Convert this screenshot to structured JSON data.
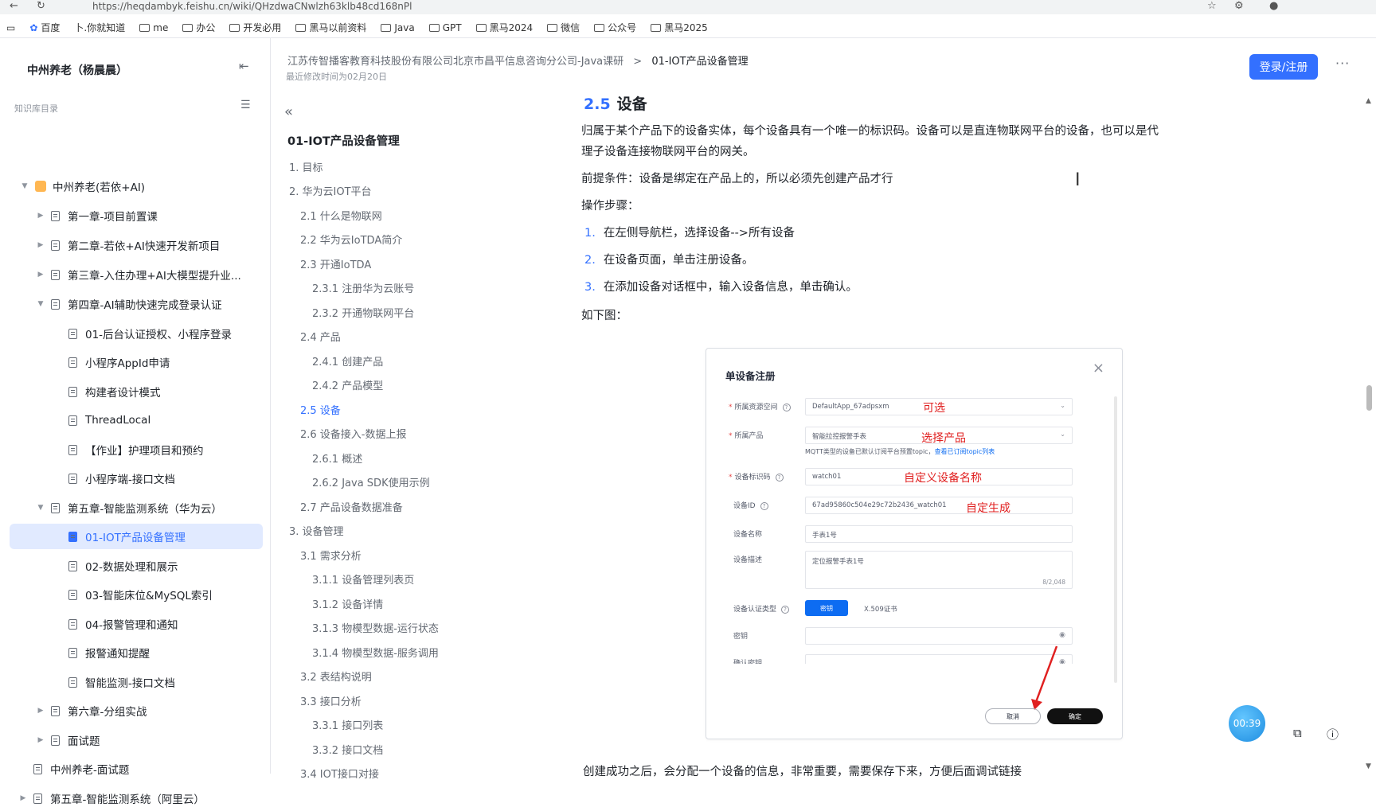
{
  "browser": {
    "url": "https://heqdambyk.feishu.cn/wiki/QHzdwaCNwlzh63klb48cd168nPl",
    "bookmarks": [
      "百度",
      "卜.你就知道",
      "me",
      "办公",
      "开发必用",
      "黑马以前资料",
      "Java",
      "GPT",
      "黑马2024",
      "微信",
      "公众号",
      "黑马2025"
    ]
  },
  "sidebar": {
    "title": "中州养老（杨晨晨）",
    "subtitle": "知识库目录",
    "items": [
      {
        "label": "中州养老(若依+AI)"
      },
      {
        "label": "第一章-项目前置课"
      },
      {
        "label": "第二章-若依+AI快速开发新项目"
      },
      {
        "label": "第三章-入住办理+AI大模型提升业..."
      },
      {
        "label": "第四章-AI辅助快速完成登录认证"
      },
      {
        "label": "01-后台认证授权、小程序登录"
      },
      {
        "label": "小程序AppId申请"
      },
      {
        "label": "构建者设计模式"
      },
      {
        "label": "ThreadLocal"
      },
      {
        "label": "【作业】护理项目和预约"
      },
      {
        "label": "小程序端-接口文档"
      },
      {
        "label": "第五章-智能监测系统（华为云）"
      },
      {
        "label": "01-IOT产品设备管理"
      },
      {
        "label": "02-数据处理和展示"
      },
      {
        "label": "03-智能床位&MySQL索引"
      },
      {
        "label": "04-报警管理和通知"
      },
      {
        "label": "报警通知提醒"
      },
      {
        "label": "智能监测-接口文档"
      },
      {
        "label": "第六章-分组实战"
      },
      {
        "label": "面试题"
      },
      {
        "label": "中州养老-面试题"
      },
      {
        "label": "第五章-智能监测系统（阿里云）"
      }
    ]
  },
  "header": {
    "breadcrumb_parent": "江苏传智播客教育科技股份有限公司北京市昌平信息咨询分公司-Java课研",
    "breadcrumb_sep": ">",
    "breadcrumb_current": "01-IOT产品设备管理",
    "updated": "最近修改时间为02月20日",
    "login_label": "登录/注册",
    "more_label": "···"
  },
  "toc": {
    "title": "01-IOT产品设备管理",
    "items": [
      {
        "label": "1. 目标"
      },
      {
        "label": "2. 华为云IOT平台"
      },
      {
        "label": "2.1 什么是物联网"
      },
      {
        "label": "2.2 华为云IoTDA简介"
      },
      {
        "label": "2.3 开通IoTDA"
      },
      {
        "label": "2.3.1 注册华为云账号"
      },
      {
        "label": "2.3.2 开通物联网平台"
      },
      {
        "label": "2.4 产品"
      },
      {
        "label": "2.4.1 创建产品"
      },
      {
        "label": "2.4.2 产品模型"
      },
      {
        "label": "2.5 设备"
      },
      {
        "label": "2.6 设备接入-数据上报"
      },
      {
        "label": "2.6.1 概述"
      },
      {
        "label": "2.6.2 Java SDK使用示例"
      },
      {
        "label": "2.7 产品设备数据准备"
      },
      {
        "label": "3. 设备管理"
      },
      {
        "label": "3.1 需求分析"
      },
      {
        "label": "3.1.1 设备管理列表页"
      },
      {
        "label": "3.1.2 设备详情"
      },
      {
        "label": "3.1.3 物模型数据-运行状态"
      },
      {
        "label": "3.1.4 物模型数据-服务调用"
      },
      {
        "label": "3.2 表结构说明"
      },
      {
        "label": "3.3 接口分析"
      },
      {
        "label": "3.3.1 接口列表"
      },
      {
        "label": "3.3.2 接口文档"
      },
      {
        "label": "3.4 IOT接口对接"
      }
    ]
  },
  "content": {
    "heading_num": "2.5",
    "heading_text": "设备",
    "para1_line1": "归属于某个产品下的设备实体，每个设备具有一个唯一的标识码。设备可以是直连物联网平台的设备，也可以是代",
    "para1_line2": "理子设备连接物联网平台的网关。",
    "para2": "前提条件：设备是绑定在产品上的，所以必须先创建产品才行",
    "para3": "操作步骤：",
    "steps": [
      {
        "num": "1.",
        "text": "在左侧导航栏，选择设备-->所有设备"
      },
      {
        "num": "2.",
        "text": "在设备页面，单击注册设备。"
      },
      {
        "num": "3.",
        "text": "在添加设备对话框中，输入设备信息，单击确认。"
      }
    ],
    "para4": "如下图：",
    "bottom_text": "创建成功之后，会分配一个设备的信息，非常重要，需要保存下来，方便后面调试链接"
  },
  "dialog": {
    "title": "单设备注册",
    "close": "×",
    "fields": {
      "resource_label": "所属资源空间",
      "resource_value": "DefaultApp_67adpsxm",
      "resource_anno": "可选",
      "product_label": "所属产品",
      "product_value": "智能拉控报警手表",
      "product_anno": "选择产品",
      "product_hint": "MQTT类型的设备已默认订阅平台预置topic，",
      "product_hint_link": "查看已订阅topic列表",
      "node_label": "设备标识码",
      "node_value": "watch01",
      "node_anno": "自定义设备名称",
      "id_label": "设备ID",
      "id_value": "67ad95860c504e29c72b2436_watch01",
      "id_anno": "自定生成",
      "name_label": "设备名称",
      "name_value": "手表1号",
      "desc_label": "设备描述",
      "desc_value": "定位报警手表1号",
      "desc_count": "8/2,048",
      "auth_label": "设备认证类型",
      "auth_selected": "密钥",
      "auth_alt": "X.509证书",
      "secret_label": "密钥",
      "confirm_label": "确认密钥"
    },
    "cancel_label": "取消",
    "ok_label": "确定"
  },
  "float": {
    "timer": "00:39"
  },
  "colors": {
    "accent": "#3370ff",
    "annotation": "#e02020"
  }
}
